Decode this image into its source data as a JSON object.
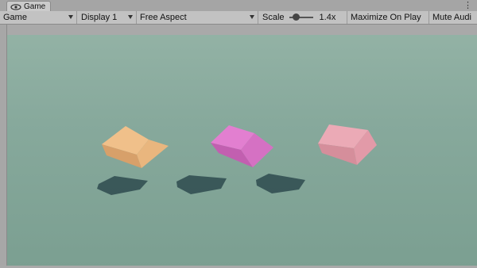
{
  "tab": {
    "title": "Game",
    "icon": "game-eye-icon",
    "menu_icon": "kebab-menu-icon"
  },
  "toolbar": {
    "view_mode": "Game",
    "display": "Display 1",
    "aspect": "Free Aspect",
    "scale_label": "Scale",
    "scale_value": "1.4x",
    "maximize": "Maximize On Play",
    "mute": "Mute Audi"
  },
  "scene": {
    "background_color": "#8aab9e",
    "cubes": [
      {
        "name": "orange-cube",
        "color": "#e8b479"
      },
      {
        "name": "magenta-cube",
        "color": "#d670c0"
      },
      {
        "name": "pink-cube",
        "color": "#e29aa8"
      }
    ],
    "shadow_color": "#2e4a4d"
  }
}
